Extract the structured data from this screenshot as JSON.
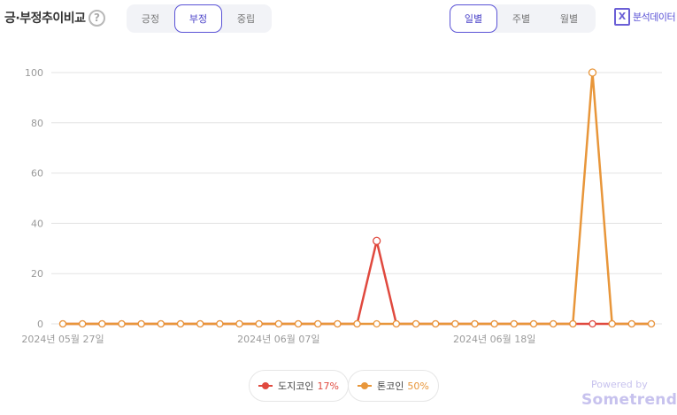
{
  "header": {
    "title": "긍·부정추이비교",
    "help_glyph": "?",
    "sentiment_tabs": [
      {
        "label": "긍정",
        "active": false
      },
      {
        "label": "부정",
        "active": true
      },
      {
        "label": "중립",
        "active": false
      }
    ],
    "period_tabs": [
      {
        "label": "일별",
        "active": true
      },
      {
        "label": "주별",
        "active": false
      },
      {
        "label": "월별",
        "active": false
      }
    ],
    "export_glyph": "X",
    "export_label": "분석데이터",
    "accent_color": "#5a52d6"
  },
  "chart_data": {
    "type": "line",
    "ylim": [
      0,
      100
    ],
    "y_ticks": [
      0,
      20,
      40,
      60,
      80,
      100
    ],
    "grid": true,
    "x_count": 31,
    "x_tick_labels": [
      {
        "index": 0,
        "label": "2024년 05월 27일"
      },
      {
        "index": 11,
        "label": "2024년 06월 07일"
      },
      {
        "index": 22,
        "label": "2024년 06월 18일"
      }
    ],
    "series": [
      {
        "name": "도지코인",
        "percent": "17%",
        "color": "#e0493e",
        "values": [
          0,
          0,
          0,
          0,
          0,
          0,
          0,
          0,
          0,
          0,
          0,
          0,
          0,
          0,
          0,
          0,
          33,
          0,
          0,
          0,
          0,
          0,
          0,
          0,
          0,
          0,
          0,
          0,
          0,
          0,
          0
        ]
      },
      {
        "name": "톤코인",
        "percent": "50%",
        "color": "#e8963a",
        "values": [
          0,
          0,
          0,
          0,
          0,
          0,
          0,
          0,
          0,
          0,
          0,
          0,
          0,
          0,
          0,
          0,
          0,
          0,
          0,
          0,
          0,
          0,
          0,
          0,
          0,
          0,
          0,
          100,
          0,
          0,
          0
        ]
      }
    ]
  },
  "footer": {
    "powered_by": "Powered by",
    "brand": "Sometrend"
  }
}
